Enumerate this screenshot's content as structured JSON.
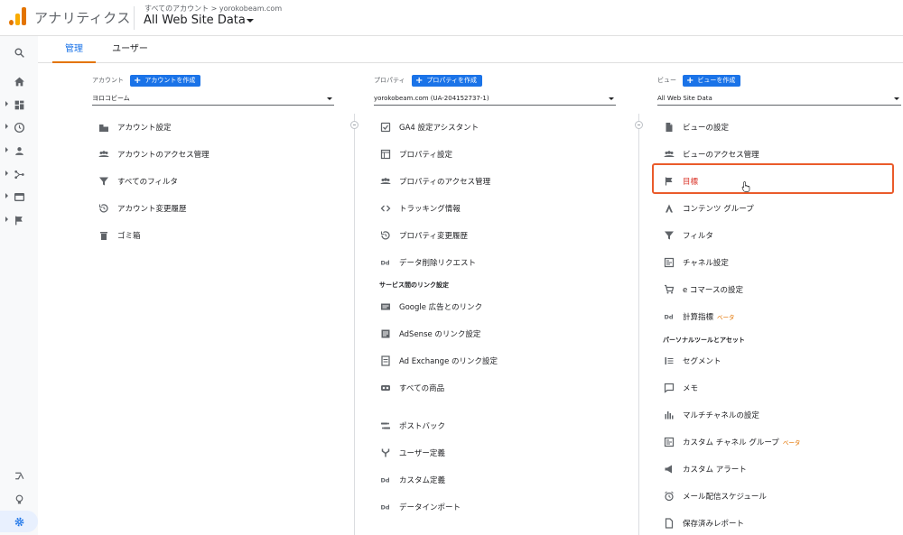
{
  "header": {
    "app_name": "アナリティクス",
    "breadcrumb": "すべてのアカウント > yorokobeam.com",
    "view_name": "All Web Site Data"
  },
  "tabs": [
    {
      "label": "管理",
      "active": true
    },
    {
      "label": "ユーザー",
      "active": false
    }
  ],
  "rail_icons": [
    "search-icon",
    "home-icon",
    "dashboard-icon",
    "clock-icon",
    "person-icon",
    "acquisition-icon",
    "behavior-icon",
    "flag-icon",
    "attribution-icon",
    "lightbulb-icon",
    "gear-icon"
  ],
  "account": {
    "heading": "アカウント",
    "create_label": "アカウントを作成",
    "selected": "ヨロコビーム",
    "items": [
      {
        "label": "アカウント設定",
        "icon": "building-icon"
      },
      {
        "label": "アカウントのアクセス管理",
        "icon": "people-icon"
      },
      {
        "label": "すべてのフィルタ",
        "icon": "filter-icon"
      },
      {
        "label": "アカウント変更履歴",
        "icon": "history-icon"
      },
      {
        "label": "ゴミ箱",
        "icon": "trash-icon"
      }
    ]
  },
  "property": {
    "heading": "プロパティ",
    "create_label": "プロパティを作成",
    "selected": "yorokobeam.com (UA-204152737-1)",
    "items": [
      {
        "label": "GA4 設定アシスタント",
        "icon": "checkbox-icon"
      },
      {
        "label": "プロパティ設定",
        "icon": "window-icon"
      },
      {
        "label": "プロパティのアクセス管理",
        "icon": "people-icon"
      },
      {
        "label": "トラッキング情報",
        "icon": "code-icon"
      },
      {
        "label": "プロパティ変更履歴",
        "icon": "history-icon"
      },
      {
        "label": "データ削除リクエスト",
        "icon": "dd-icon"
      }
    ],
    "section_label": "サービス間のリンク設定",
    "link_items": [
      {
        "label": "Google 広告とのリンク",
        "icon": "ads-icon"
      },
      {
        "label": "AdSense のリンク設定",
        "icon": "adsense-icon"
      },
      {
        "label": "Ad Exchange のリンク設定",
        "icon": "adexchange-icon"
      },
      {
        "label": "すべての商品",
        "icon": "link-icon"
      }
    ],
    "other_items": [
      {
        "label": "ポストバック",
        "icon": "postback-icon"
      },
      {
        "label": "ユーザー定義",
        "icon": "fork-icon"
      },
      {
        "label": "カスタム定義",
        "icon": "dd-icon"
      },
      {
        "label": "データインポート",
        "icon": "dd-icon"
      }
    ]
  },
  "view": {
    "heading": "ビュー",
    "create_label": "ビューを作成",
    "selected": "All Web Site Data",
    "items": [
      {
        "label": "ビューの設定",
        "icon": "document-icon"
      },
      {
        "label": "ビューのアクセス管理",
        "icon": "people-icon"
      },
      {
        "label": "目標",
        "icon": "flag-icon",
        "highlighted": true
      },
      {
        "label": "コンテンツ グループ",
        "icon": "person-walk-icon"
      },
      {
        "label": "フィルタ",
        "icon": "filter-icon"
      },
      {
        "label": "チャネル設定",
        "icon": "channel-icon"
      },
      {
        "label": "e コマースの設定",
        "icon": "cart-icon"
      },
      {
        "label": "計算指標",
        "icon": "dd-icon",
        "beta": "ベータ"
      }
    ],
    "section_label": "パーソナルツールとアセット",
    "personal_items": [
      {
        "label": "セグメント",
        "icon": "segment-icon"
      },
      {
        "label": "メモ",
        "icon": "note-icon"
      },
      {
        "label": "マルチチャネルの設定",
        "icon": "bar-chart-icon"
      },
      {
        "label": "カスタム チャネル グループ",
        "icon": "channel-icon",
        "beta": "ベータ"
      },
      {
        "label": "カスタム アラート",
        "icon": "megaphone-icon"
      },
      {
        "label": "メール配信スケジュール",
        "icon": "alarm-icon"
      },
      {
        "label": "保存済みレポート",
        "icon": "document-icon"
      }
    ]
  },
  "colors": {
    "accent_blue": "#1a73e8",
    "highlight_orange": "#ea5b2b",
    "tab_underline": "#e37400"
  }
}
